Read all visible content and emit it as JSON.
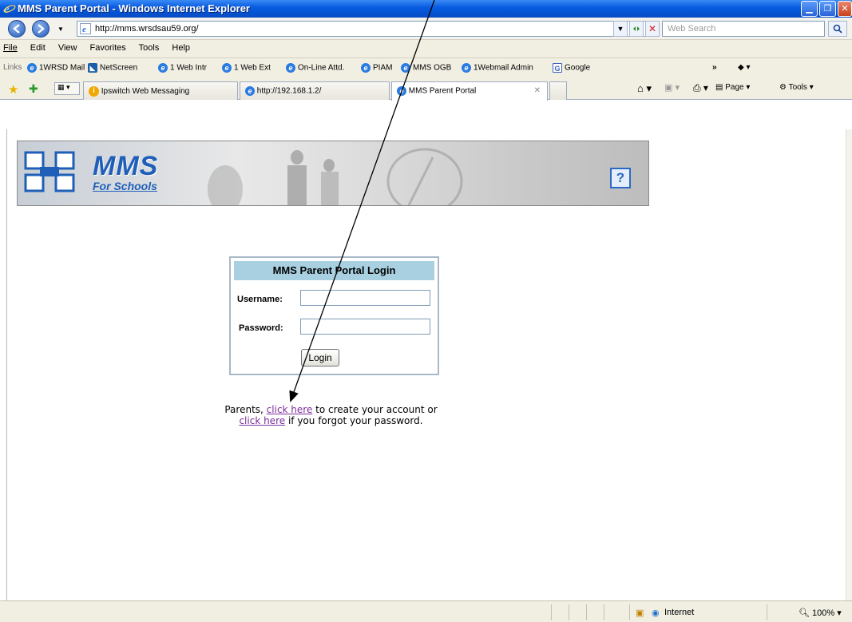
{
  "window": {
    "title": "MMS Parent Portal - Windows Internet Explorer"
  },
  "addressbar": {
    "url": "http://mms.wrsdsau59.org/",
    "search_placeholder": "Web Search"
  },
  "menu": {
    "items": [
      "File",
      "Edit",
      "View",
      "Favorites",
      "Tools",
      "Help"
    ]
  },
  "links": {
    "label": "Links",
    "items": [
      "1WRSD Mail",
      "NetScreen",
      "1 Web Intr",
      "1 Web Ext",
      "On-Line Attd.",
      "PIAM",
      "MMS OGB",
      "1Webmail Admin",
      "Google"
    ],
    "overflow": "»"
  },
  "tabs": {
    "items": [
      "Ipswitch Web Messaging",
      "http://192.168.1.2/",
      "MMS Parent Portal"
    ]
  },
  "toolbar": {
    "page": "Page",
    "tools": "Tools"
  },
  "banner": {
    "logo": "MMS",
    "logo_sub": "For Schools",
    "help": "?"
  },
  "login": {
    "title": "MMS Parent Portal Login",
    "username_label": "Username:",
    "password_label": "Password:",
    "username_value": "",
    "password_value": "",
    "button": "Login"
  },
  "info": {
    "prefix": "Parents,",
    "link1": "click here",
    "mid": "to create your account or",
    "link2": "click here",
    "suffix": "if you forgot your password."
  },
  "status": {
    "zone": "Internet",
    "zoom": "100%"
  }
}
